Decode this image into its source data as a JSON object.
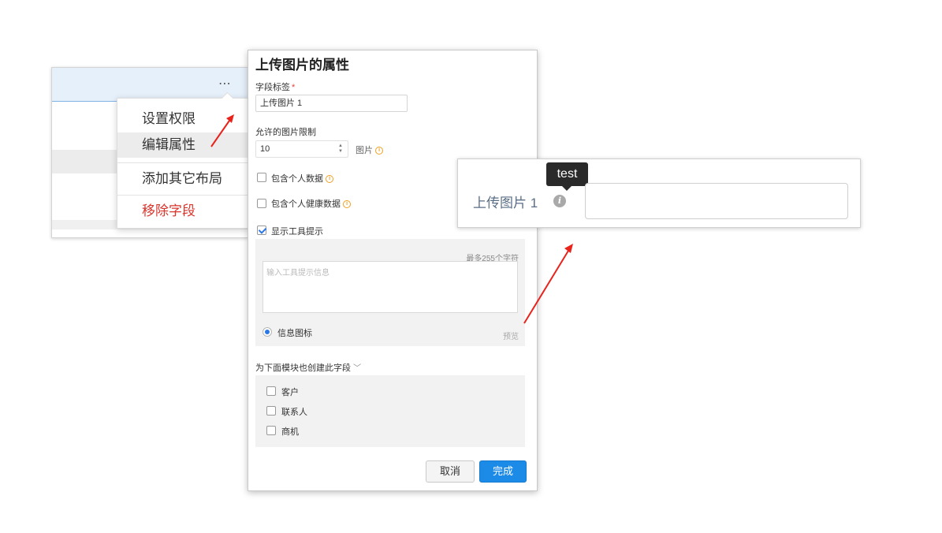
{
  "context_menu": {
    "more_icon": "⋯",
    "items": [
      {
        "label": "设置权限"
      },
      {
        "label": "编辑属性"
      },
      {
        "label": "添加其它布局"
      },
      {
        "label": "移除字段"
      }
    ]
  },
  "dialog": {
    "title": "上传图片的属性",
    "field_label": {
      "label": "字段标签",
      "required_mark": "*",
      "value": "上传图片 1"
    },
    "image_limit": {
      "label": "允许的图片限制",
      "value": "10",
      "unit": "图片"
    },
    "personal_data": {
      "label": "包含个人数据",
      "checked": false
    },
    "health_data": {
      "label": "包含个人健康数据",
      "checked": false
    },
    "show_tooltip": {
      "label": "显示工具提示",
      "checked": true
    },
    "tooltip_box": {
      "max_chars": "最多255个字符",
      "placeholder": "输入工具提示信息",
      "option_label": "信息图标",
      "preview_link": "预览"
    },
    "modules": {
      "label": "为下面模块也创建此字段",
      "items": [
        {
          "label": "客户",
          "checked": false
        },
        {
          "label": "联系人",
          "checked": false
        },
        {
          "label": "商机",
          "checked": false
        }
      ]
    },
    "buttons": {
      "cancel": "取消",
      "done": "完成"
    }
  },
  "preview": {
    "field_label": "上传图片 1",
    "info_icon": "i",
    "tooltip_text": "test"
  },
  "colors": {
    "accent": "#1c8be8",
    "danger": "#d9352b",
    "arrow": "#e8231b",
    "info": "#f0a020"
  }
}
